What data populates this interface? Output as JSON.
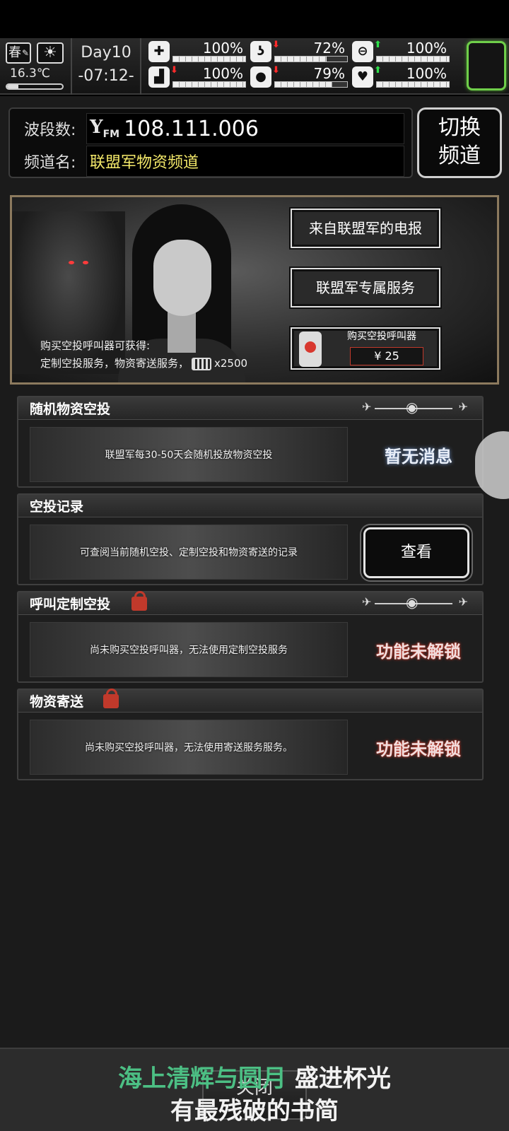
{
  "status": {
    "season": "春",
    "temperature": "16.3℃",
    "temperature_level": 0.2,
    "day": "Day10",
    "clock": "-07:12-",
    "stats": [
      {
        "name": "health",
        "icon": "medkit-icon",
        "value": "100%",
        "level": 1.0,
        "trend": ""
      },
      {
        "name": "hunger",
        "icon": "stomach-icon",
        "value": "72%",
        "level": 0.72,
        "trend": "down"
      },
      {
        "name": "mood",
        "icon": "pill-icon",
        "value": "100%",
        "level": 1.0,
        "trend": "up"
      },
      {
        "name": "stamina",
        "icon": "boot-icon",
        "value": "100%",
        "level": 1.0,
        "trend": "down"
      },
      {
        "name": "thirst",
        "icon": "water-drop-icon",
        "value": "79%",
        "level": 0.79,
        "trend": "down"
      },
      {
        "name": "heart",
        "icon": "heart-icon",
        "value": "100%",
        "level": 1.0,
        "trend": "up"
      }
    ]
  },
  "radio": {
    "band_label": "波段数:",
    "fm_icon_main": "Y",
    "fm_icon_sub": "FM",
    "frequency": "108.111.006",
    "channel_label": "频道名:",
    "channel_name": "联盟军物资频道",
    "switch_line1": "切换",
    "switch_line2": "频道"
  },
  "banner": {
    "btn_telegram": "来自联盟军的电报",
    "btn_service": "联盟军专属服务",
    "buy_label": "购买空投呼叫器",
    "price": "¥ 25",
    "info_line1": "购买空投呼叫器可获得:",
    "info_line2": "定制空投服务，物资寄送服务，",
    "info_qty": "x2500"
  },
  "sections": [
    {
      "title": "随机物资空投",
      "desc": "联盟军每30-50天会随机投放物资空投",
      "status": "暂无消息"
    },
    {
      "title": "空投记录",
      "desc": "可查阅当前随机空投、定制空投和物资寄送的记录",
      "button": "查看"
    },
    {
      "title": "呼叫定制空投",
      "desc": "尚未购买空投呼叫器，无法使用定制空投服务",
      "status": "功能未解锁"
    },
    {
      "title": "物资寄送",
      "desc": "尚未购买空投呼叫器，无法使用寄送服务服务。",
      "status": "功能未解锁"
    }
  ],
  "bottom": {
    "close_label": "关闭",
    "lyric_green": "海上清辉与圆月",
    "lyric_white": " 盛进杯光",
    "lyric_line2": "有最残破的书简"
  },
  "colors": {
    "accent_green": "#6fcf4a",
    "lyric_green": "#4cbf84",
    "lock_red": "#c0392b",
    "channel_yellow": "#f4e96a"
  }
}
